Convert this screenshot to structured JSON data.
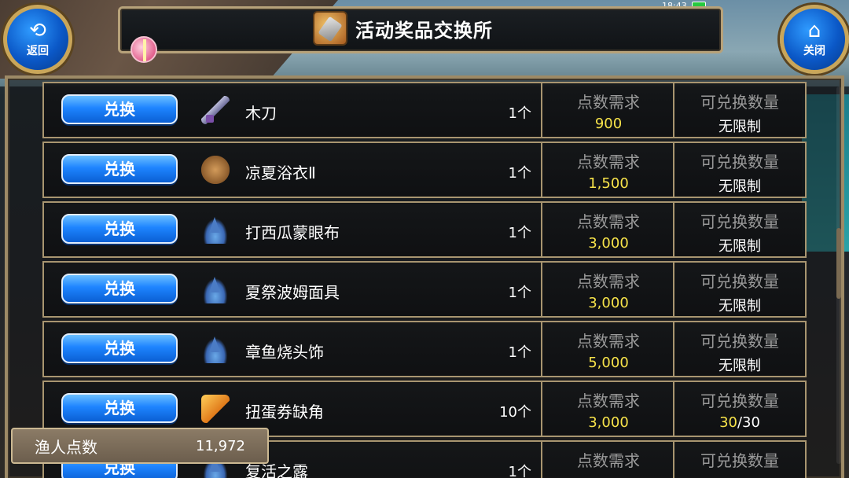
{
  "status": {
    "time": "18:43"
  },
  "nav": {
    "back_label": "返回",
    "close_label": "关闭"
  },
  "header": {
    "title": "活动奖品交换所"
  },
  "row_labels": {
    "exchange": "兑换",
    "points_header": "点数需求",
    "limit_header": "可兑换数量"
  },
  "items": [
    {
      "name": "木刀",
      "qty": "1个",
      "points": "900",
      "limit": "无限制",
      "icon": "sword-icon"
    },
    {
      "name": "凉夏浴衣Ⅱ",
      "qty": "1个",
      "points": "1,500",
      "limit": "无限制",
      "icon": "clothes-icon"
    },
    {
      "name": "打西瓜蒙眼布",
      "qty": "1个",
      "points": "3,000",
      "limit": "无限制",
      "icon": "hat-icon"
    },
    {
      "name": "夏祭波姆面具",
      "qty": "1个",
      "points": "3,000",
      "limit": "无限制",
      "icon": "hat-icon"
    },
    {
      "name": "章鱼烧头饰",
      "qty": "1个",
      "points": "5,000",
      "limit": "无限制",
      "icon": "hat-icon"
    },
    {
      "name": "扭蛋券缺角",
      "qty": "10个",
      "points": "3,000",
      "limit_current": "30",
      "limit_total": "/30",
      "icon": "ticket-icon"
    },
    {
      "name": "复活之露",
      "qty": "1个",
      "points": "",
      "limit": "",
      "icon": "potion-icon"
    }
  ],
  "footer": {
    "points_label": "渔人点数",
    "points_value": "11,972"
  }
}
